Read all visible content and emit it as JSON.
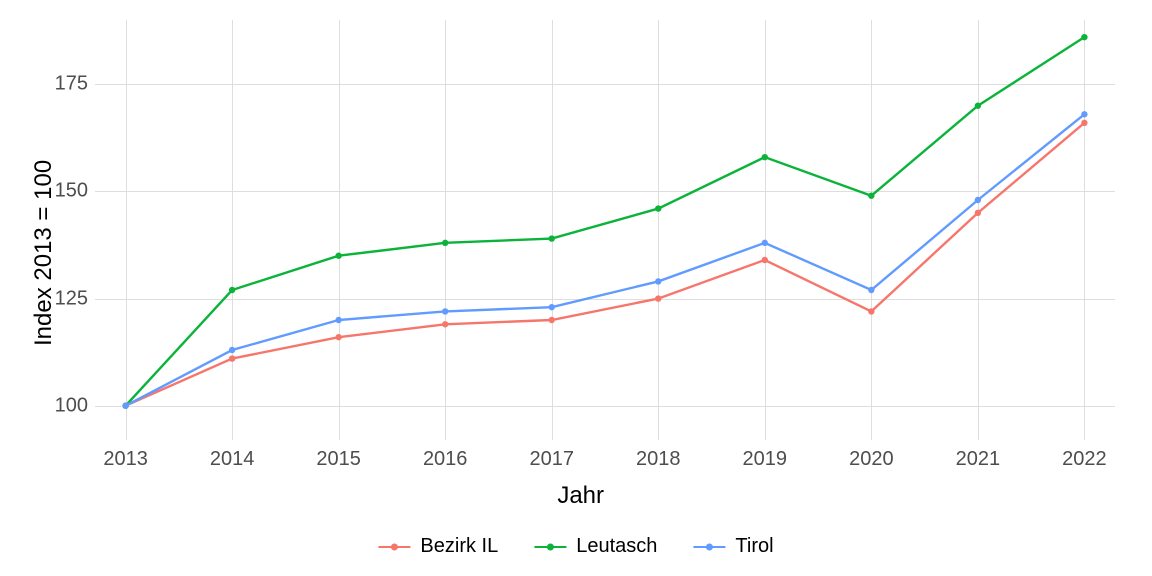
{
  "chart_data": {
    "type": "line",
    "xlabel": "Jahr",
    "ylabel": "Index  2013  = 100",
    "categories": [
      "2013",
      "2014",
      "2015",
      "2016",
      "2017",
      "2018",
      "2019",
      "2020",
      "2021",
      "2022"
    ],
    "y_ticks": [
      100,
      125,
      150,
      175
    ],
    "ylim": [
      92,
      190
    ],
    "series": [
      {
        "name": "Bezirk IL",
        "color": "#f7766c",
        "values": [
          100,
          111,
          116,
          119,
          120,
          125,
          134,
          122,
          145,
          166
        ]
      },
      {
        "name": "Leutasch",
        "color": "#0bb33a",
        "values": [
          100,
          127,
          135,
          138,
          139,
          146,
          158,
          149,
          170,
          186
        ]
      },
      {
        "name": "Tirol",
        "color": "#619bff",
        "values": [
          100,
          113,
          120,
          122,
          123,
          129,
          138,
          127,
          148,
          168
        ]
      }
    ],
    "legend_order": [
      "Bezirk IL",
      "Leutasch",
      "Tirol"
    ]
  }
}
